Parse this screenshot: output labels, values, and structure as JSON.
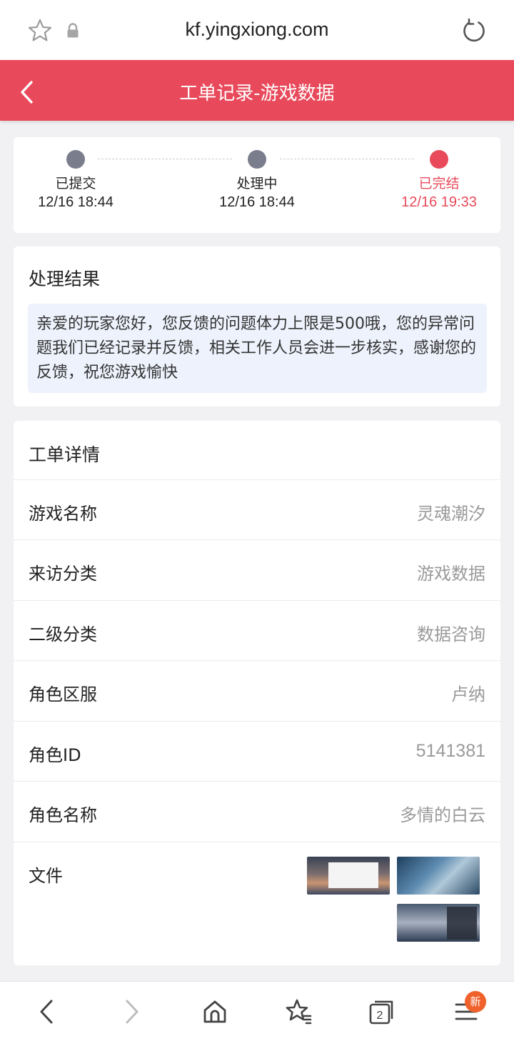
{
  "browser": {
    "url": "kf.yingxiong.com"
  },
  "header": {
    "title": "工单记录-游戏数据"
  },
  "progress": {
    "steps": [
      {
        "label": "已提交",
        "time": "12/16 18:44"
      },
      {
        "label": "处理中",
        "time": "12/16 18:44"
      },
      {
        "label": "已完结",
        "time": "12/16 19:33"
      }
    ]
  },
  "result": {
    "title": "处理结果",
    "message": "亲爱的玩家您好，您反馈的问题体力上限是500哦，您的异常问题我们已经记录并反馈，相关工作人员会进一步核实，感谢您的反馈，祝您游戏愉快"
  },
  "details": {
    "title": "工单详情",
    "rows": [
      {
        "key": "游戏名称",
        "value": "灵魂潮汐"
      },
      {
        "key": "来访分类",
        "value": "游戏数据"
      },
      {
        "key": "二级分类",
        "value": "数据咨询"
      },
      {
        "key": "角色区服",
        "value": "卢纳"
      },
      {
        "key": "角色ID",
        "value": "5141381"
      },
      {
        "key": "角色名称",
        "value": "多情的白云"
      }
    ],
    "files_label": "文件"
  },
  "bottom_nav": {
    "badge": "新"
  },
  "colors": {
    "accent": "#e84a5b",
    "dot_inactive": "#7a7d8c",
    "badge": "#f0622c"
  }
}
